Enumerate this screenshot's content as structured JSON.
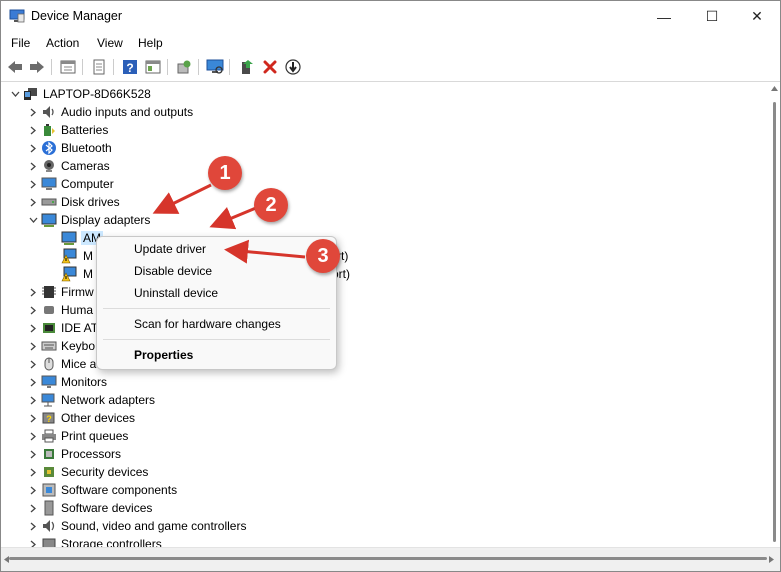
{
  "window": {
    "title": "Device Manager",
    "minimize": "—",
    "maximize": "☐",
    "close": "✕"
  },
  "menu": [
    "File",
    "Action",
    "View",
    "Help"
  ],
  "tree": {
    "root": "LAPTOP-8D66K528",
    "categories": [
      {
        "label": "Audio inputs and outputs",
        "icon": "speaker-icon"
      },
      {
        "label": "Batteries",
        "icon": "battery-icon"
      },
      {
        "label": "Bluetooth",
        "icon": "bluetooth-icon"
      },
      {
        "label": "Cameras",
        "icon": "camera-icon"
      },
      {
        "label": "Computer",
        "icon": "computer-icon"
      },
      {
        "label": "Disk drives",
        "icon": "disk-icon"
      },
      {
        "label": "Display adapters",
        "icon": "display-adapter-icon",
        "expanded": true
      },
      {
        "label": "Firmw",
        "icon": "firmware-icon"
      },
      {
        "label": "Huma",
        "icon": "hid-icon"
      },
      {
        "label": "IDE AT",
        "icon": "ide-icon"
      },
      {
        "label": "Keybo",
        "icon": "keyboard-icon"
      },
      {
        "label": "Mice a",
        "icon": "mouse-icon"
      },
      {
        "label": "Monitors",
        "icon": "monitor-icon"
      },
      {
        "label": "Network adapters",
        "icon": "network-icon"
      },
      {
        "label": "Other devices",
        "icon": "other-devices-icon"
      },
      {
        "label": "Print queues",
        "icon": "printer-icon"
      },
      {
        "label": "Processors",
        "icon": "processor-icon"
      },
      {
        "label": "Security devices",
        "icon": "security-icon"
      },
      {
        "label": "Software components",
        "icon": "software-component-icon"
      },
      {
        "label": "Software devices",
        "icon": "software-device-icon"
      },
      {
        "label": "Sound, video and game controllers",
        "icon": "sound-icon"
      },
      {
        "label": "Storage controllers",
        "icon": "storage-icon"
      }
    ],
    "display_children": [
      {
        "label": "AM",
        "selected": true
      },
      {
        "label": "M",
        "suffix": "rt)",
        "warning": true
      },
      {
        "label": "M",
        "suffix": "ort)",
        "warning": true
      }
    ]
  },
  "context_menu": {
    "items": [
      "Update driver",
      "Disable device",
      "Uninstall device"
    ],
    "scan": "Scan for hardware changes",
    "properties": "Properties"
  },
  "annotations": [
    "1",
    "2",
    "3"
  ],
  "colors": {
    "badge": "#e0473a",
    "arrow": "#d6352b",
    "selection": "#cce8ff"
  }
}
